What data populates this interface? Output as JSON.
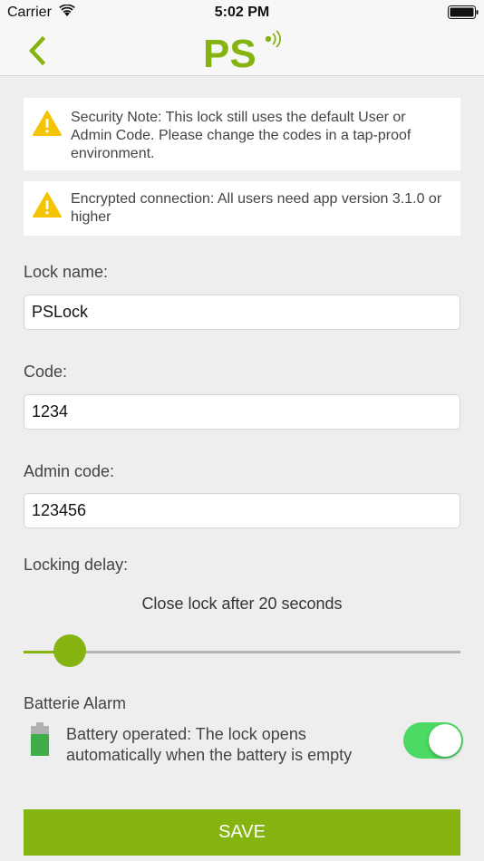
{
  "status": {
    "carrier": "Carrier",
    "time": "5:02 PM",
    "icons": [
      "wifi-icon",
      "battery-icon"
    ]
  },
  "nav": {
    "back_icon": "chevron-left-icon",
    "logo_text": "PS"
  },
  "colors": {
    "brand": "#85b30f",
    "warning": "#f5c400",
    "toggle_on": "#4cd964",
    "background": "#eeeeee"
  },
  "notes": [
    {
      "icon": "warning-icon",
      "text": "Security Note: This lock still uses the default User or Admin Code. Please change the codes in a tap-proof environment."
    },
    {
      "icon": "warning-icon",
      "text": "Encrypted connection: All users need app version 3.1.0 or higher"
    }
  ],
  "form": {
    "lock_name": {
      "label": "Lock name:",
      "value": "PSLock"
    },
    "code": {
      "label": "Code:",
      "value": "1234"
    },
    "admin_code": {
      "label": "Admin code:",
      "value": "123456"
    }
  },
  "locking_delay": {
    "label": "Locking delay:",
    "text": "Close lock after 20 seconds",
    "seconds": 20,
    "slider_fraction": 0.105
  },
  "battery_alarm": {
    "title": "Batterie Alarm",
    "icon": "battery-icon",
    "text": "Battery operated: The lock opens automatically when the battery is empty",
    "enabled": true
  },
  "save_label": "SAVE"
}
